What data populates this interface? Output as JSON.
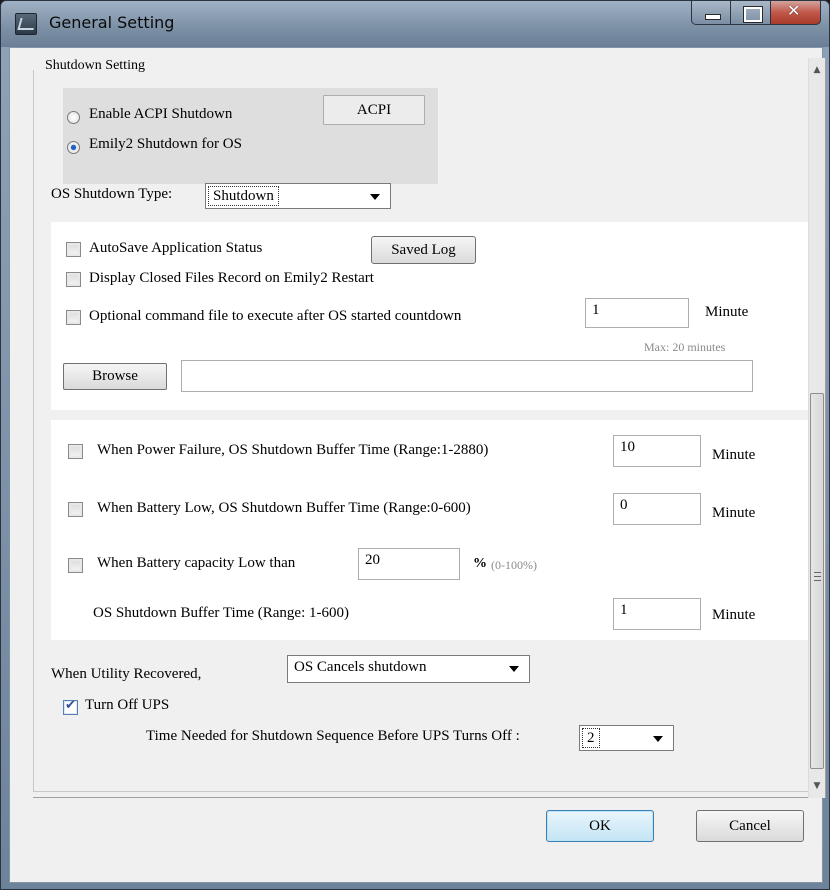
{
  "window": {
    "title": "General Setting"
  },
  "group": {
    "title": "Shutdown Setting"
  },
  "acpi": {
    "enable_label": "Enable ACPI Shutdown",
    "emily_label": "Emily2 Shutdown for  OS",
    "acpi_button": "ACPI",
    "selected": "emily"
  },
  "os_type": {
    "label": "OS Shutdown Type:",
    "value": "Shutdown"
  },
  "panel1": {
    "autosave_label": "AutoSave Application Status",
    "saved_log_button": "Saved Log",
    "display_closed_label": "Display Closed Files Record on Emily2 Restart",
    "optional_cmd_label": "Optional command file to execute after OS  started countdown",
    "countdown_value": "1",
    "countdown_unit": "Minute",
    "max_hint": "Max: 20 minutes",
    "browse_button": "Browse",
    "path_value": ""
  },
  "panel2": {
    "power_failure_label": "When Power Failure, OS Shutdown Buffer Time (Range:1-2880)",
    "power_failure_value": "10",
    "battery_low_label": "When Battery Low, OS Shutdown Buffer Time (Range:0-600)",
    "battery_low_value": "0",
    "capacity_label": "When Battery capacity Low than",
    "capacity_value": "20",
    "percent_symbol": "%",
    "percent_hint": "(0-100%)",
    "buffer_label": "OS Shutdown Buffer Time (Range: 1-600)",
    "buffer_value": "1",
    "unit": "Minute"
  },
  "recovered": {
    "label": "When Utility Recovered,",
    "value": "OS Cancels shutdown"
  },
  "ups": {
    "turn_off_label": "Turn Off UPS",
    "turn_off_checked": true,
    "sequence_label": "Time Needed for Shutdown Sequence Before UPS Turns Off :",
    "sequence_value": "2"
  },
  "footer": {
    "ok": "OK",
    "cancel": "Cancel"
  }
}
